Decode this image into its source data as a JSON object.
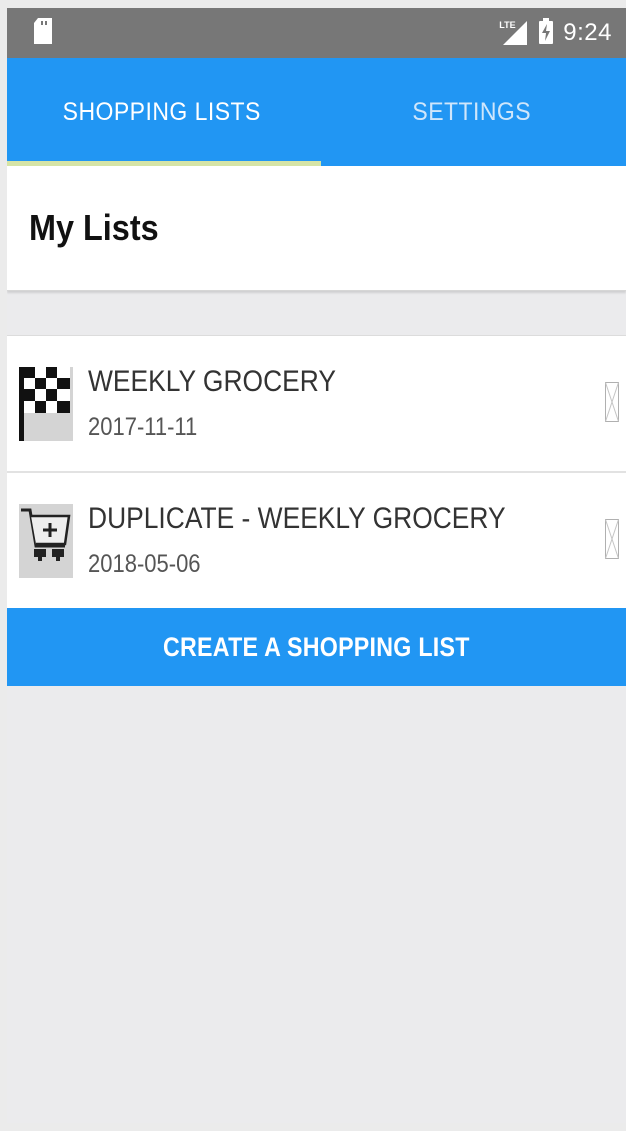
{
  "status_bar": {
    "time": "9:24",
    "network_label": "LTE",
    "icons": [
      "sd-card-icon",
      "lte-signal-icon",
      "battery-charging-icon"
    ]
  },
  "tabs": [
    {
      "label": "SHOPPING LISTS",
      "active": true
    },
    {
      "label": "SETTINGS",
      "active": false
    }
  ],
  "header": {
    "title": "My Lists"
  },
  "lists": [
    {
      "name": "WEEKLY GROCERY",
      "date": "2017-11-11",
      "icon": "checkered-flag-icon"
    },
    {
      "name": "DUPLICATE - WEEKLY GROCERY",
      "date": "2018-05-06",
      "icon": "cart-add-icon"
    }
  ],
  "create_button": {
    "label": "CREATE A SHOPPING LIST"
  },
  "colors": {
    "primary": "#2196f3",
    "tab_indicator": "#d6e4a6",
    "status_bar": "#777777",
    "background": "#ebebed"
  }
}
